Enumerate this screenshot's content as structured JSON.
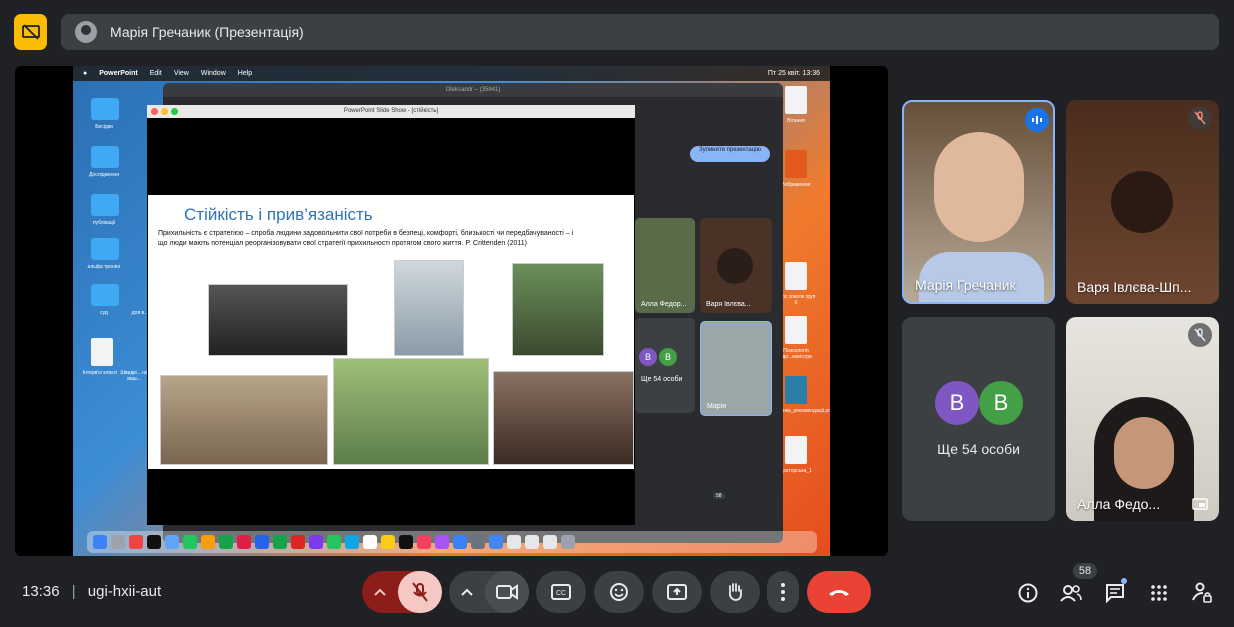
{
  "top_bar": {
    "presenter_label": "Марія Гречаник (Презентація)"
  },
  "stage": {
    "mac_menubar": {
      "app": "PowerPoint",
      "menus": [
        "Edit",
        "View",
        "Window",
        "Help"
      ],
      "clock": "Пт 25 квіт. 13:36"
    },
    "background_window_title": "Oleksandr – (35841)",
    "stop_presenting_label": "Зупинити презентацію",
    "mini_tiles": [
      "Алла Федор...",
      "Варя Івлєва...",
      "Ще 54 особи",
      "Марія"
    ],
    "mini_count": "58",
    "slideshow_title": "PowerPoint Slide Show - [стійкість]",
    "slide": {
      "title": "Стійкість і прив’язаність",
      "text": "Прихильність є стратегією – спроба людини задовольнити свої потреби в безпеці, комфорті, близькості чи передбачуваності – і що люди мають потенціал реорганізовувати свої стратегії прихильності протягом свого життя. P. Crittenden (2011)"
    },
    "desktop_labels": [
      "Бесідки",
      "Дослідження",
      "публікації",
      "альфа тренінг",
      "суд",
      "для в...",
      "Інтерв'ю клієнт",
      "Швидкі... на ваш...",
      "Вітання",
      "Зображення",
      "Курс список груп 6",
      "Психологія здо...магістри",
      "Оцінка_рекомендації.pdf",
      "Докторська_1"
    ]
  },
  "tiles": {
    "maria": {
      "name": "Марія Гречаник"
    },
    "varia": {
      "name": "Варя Івлєва-Шп..."
    },
    "others": {
      "label": "Ще 54 особи",
      "avatar_letters": [
        "B",
        "B"
      ]
    },
    "alla": {
      "name": "Алла Федо..."
    }
  },
  "bottom": {
    "time": "13:36",
    "meeting_code": "ugi-hxii-aut",
    "participants_count": "58"
  },
  "colors": {
    "accent_yellow": "#fbbc04",
    "end_call_red": "#ea4335",
    "mic_off_bg": "#f6c8c4",
    "avatar_purple": "#7e57c2",
    "avatar_green": "#43a047"
  }
}
